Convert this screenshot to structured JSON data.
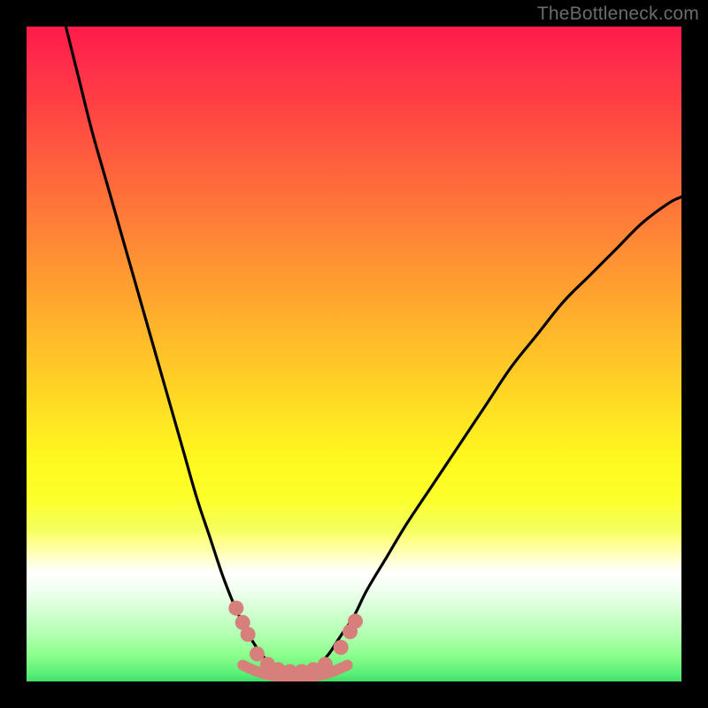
{
  "watermark": "TheBottleneck.com",
  "chart_data": {
    "type": "line",
    "title": "",
    "xlabel": "",
    "ylabel": "",
    "xlim": [
      0,
      100
    ],
    "ylim": [
      0,
      100
    ],
    "gradient_stops": [
      {
        "pos": 0,
        "color": "#ff1a4a"
      },
      {
        "pos": 24,
        "color": "#ff6a3b"
      },
      {
        "pos": 48,
        "color": "#ffbb2a"
      },
      {
        "pos": 66,
        "color": "#fff81f"
      },
      {
        "pos": 78.5,
        "color": "#ffff88"
      },
      {
        "pos": 83.5,
        "color": "#ffffff"
      },
      {
        "pos": 90,
        "color": "#ccffcc"
      },
      {
        "pos": 100,
        "color": "#44dd66"
      }
    ],
    "series": [
      {
        "name": "left-curve",
        "x": [
          6,
          8,
          10,
          12,
          14,
          16,
          18,
          20,
          22,
          24,
          26,
          28,
          30,
          32,
          34,
          36,
          38
        ],
        "y": [
          100,
          92,
          84,
          77,
          70,
          63,
          56,
          49,
          42,
          35,
          28,
          22,
          16,
          11,
          7,
          4,
          2
        ]
      },
      {
        "name": "right-curve",
        "x": [
          44,
          46,
          48,
          50,
          52,
          55,
          58,
          62,
          66,
          70,
          74,
          78,
          82,
          86,
          90,
          94,
          98,
          100
        ],
        "y": [
          2,
          4,
          7,
          10,
          14,
          19,
          24,
          30,
          36,
          42,
          48,
          53,
          58,
          62,
          66,
          70,
          73,
          74
        ]
      },
      {
        "name": "valley-floor",
        "x": [
          33,
          35,
          37,
          39,
          41,
          43,
          45,
          47,
          49
        ],
        "y": [
          2.5,
          1.6,
          1.0,
          0.7,
          0.5,
          0.7,
          1.0,
          1.6,
          2.5
        ]
      }
    ],
    "dots": {
      "name": "dots",
      "color": "#d77f7a",
      "points": [
        {
          "x": 32.0,
          "y": 11.2
        },
        {
          "x": 33.0,
          "y": 9.0
        },
        {
          "x": 33.8,
          "y": 7.2
        },
        {
          "x": 35.2,
          "y": 4.2
        },
        {
          "x": 36.8,
          "y": 2.6
        },
        {
          "x": 38.4,
          "y": 1.8
        },
        {
          "x": 40.2,
          "y": 1.5
        },
        {
          "x": 42.0,
          "y": 1.5
        },
        {
          "x": 43.8,
          "y": 1.8
        },
        {
          "x": 45.6,
          "y": 2.6
        },
        {
          "x": 48.0,
          "y": 5.2
        },
        {
          "x": 49.4,
          "y": 7.6
        },
        {
          "x": 50.2,
          "y": 9.2
        }
      ]
    }
  }
}
